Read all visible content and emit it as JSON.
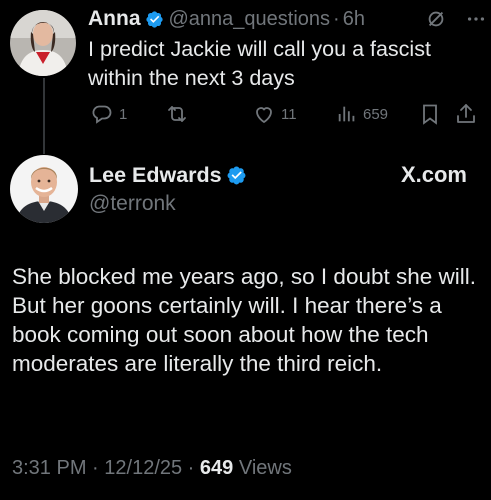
{
  "parent_tweet": {
    "author_name": "Anna",
    "handle": "@anna_questions",
    "separator": "·",
    "time": "6h",
    "text": "I predict Jackie will call you a fascist within the next 3 days",
    "replies": "1",
    "retweets": "",
    "likes": "11",
    "views": "659"
  },
  "main_tweet": {
    "author_name": "Lee Edwards",
    "handle": "@terronk",
    "link_label": "X.com",
    "text": "She blocked me years ago, so I doubt she will. But her goons certainly will. I hear there’s a book coming out soon about how the tech moderates are literally the third reich.",
    "time": "3:31 PM",
    "date": "12/12/25",
    "separator": " · ",
    "views_count": "649",
    "views_label": "Views"
  },
  "colors": {
    "background": "#000000",
    "text_primary": "#e7e9ea",
    "text_secondary": "#71767b",
    "verified": "#1d9bf0",
    "thread_line": "#333639"
  },
  "icons": [
    "verified-badge-icon",
    "grok-icon",
    "more-icon",
    "reply-icon",
    "retweet-icon",
    "like-icon",
    "views-icon",
    "bookmark-icon",
    "share-icon"
  ]
}
